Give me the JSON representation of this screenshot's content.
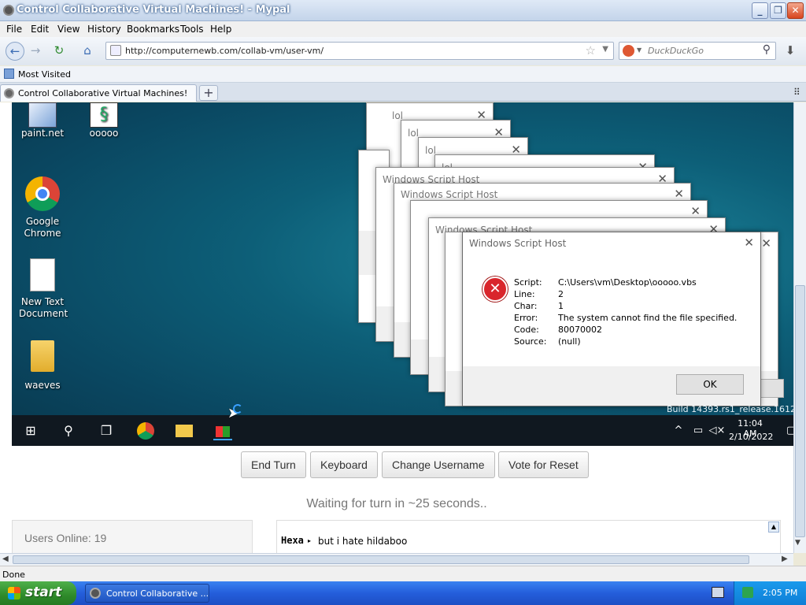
{
  "window": {
    "title": "Control Collaborative Virtual Machines! - Mypal",
    "min": "_",
    "max": "❐",
    "close": "✕"
  },
  "menu": [
    "File",
    "Edit",
    "View",
    "History",
    "Bookmarks",
    "Tools",
    "Help"
  ],
  "nav": {
    "url": "http://computernewb.com/collab-vm/user-vm/",
    "search_placeholder": "DuckDuckGo"
  },
  "bookmarks": {
    "most_visited": "Most Visited"
  },
  "tab": {
    "label": "Control Collaborative Virtual Machines!",
    "new_tab": "+"
  },
  "desktop": {
    "icons": [
      {
        "label": "paint.net"
      },
      {
        "label": "ooooo"
      },
      {
        "label": "Google Chrome"
      },
      {
        "label": "New Text Document"
      },
      {
        "label": "waeves"
      }
    ],
    "build": "Build 14393.rs1_release.161220",
    "clock": {
      "time": "11:04 AM",
      "date": "2/10/2022"
    }
  },
  "dialogs": {
    "lol_title": "lol",
    "wsh_title": "Windows Script Host",
    "error": {
      "labels": [
        "Script:",
        "Line:",
        "Char:",
        "Error:",
        "Code:",
        "Source:"
      ],
      "values": [
        "C:\\Users\\vm\\Desktop\\ooooo.vbs",
        "2",
        "1",
        "The system cannot find the file specified.",
        "80070002",
        "(null)"
      ],
      "ok": "OK"
    }
  },
  "controls": {
    "end_turn": "End Turn",
    "keyboard": "Keyboard",
    "change_username": "Change Username",
    "vote_reset": "Vote for Reset"
  },
  "turn_status": "Waiting for turn in ~25 seconds..",
  "users_online": "Users Online: 19",
  "chat": {
    "user": "Hexa",
    "message": "but i hate hildaboo"
  },
  "status_bar": "Done",
  "xp": {
    "start": "start",
    "task_item": "Control Collaborative ...",
    "time": "2:05 PM"
  }
}
